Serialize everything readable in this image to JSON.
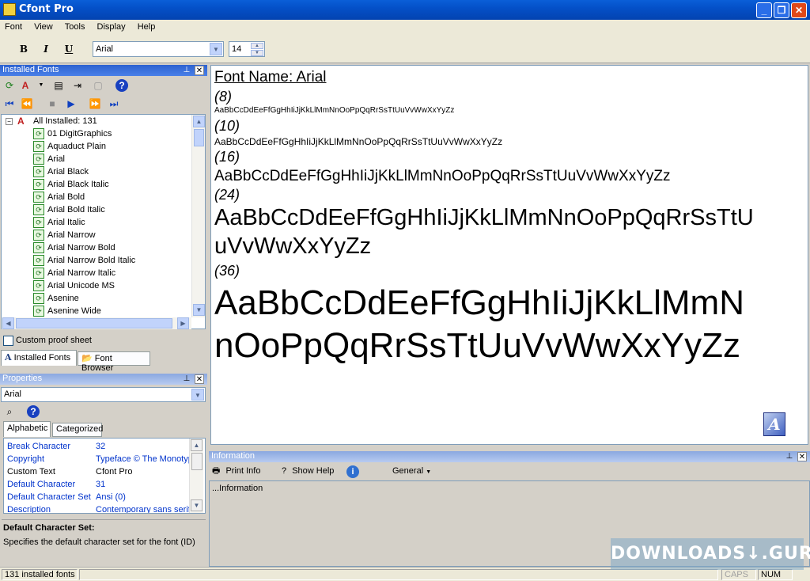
{
  "window": {
    "title": "Cfont Pro"
  },
  "menu": [
    "Font",
    "View",
    "Tools",
    "Display",
    "Help"
  ],
  "toolbar": {
    "bold": "B",
    "italic": "I",
    "underline": "U",
    "font_combo": "Arial",
    "size_value": "14"
  },
  "installed_panel": {
    "title": "Installed Fonts",
    "root_label": "All Installed: 131",
    "fonts": [
      "01 DigitGraphics",
      "Aquaduct    Plain",
      "Arial",
      "Arial Black",
      "Arial Black Italic",
      "Arial Bold",
      "Arial Bold Italic",
      "Arial Italic",
      "Arial Narrow",
      "Arial Narrow Bold",
      "Arial Narrow Bold Italic",
      "Arial Narrow Italic",
      "Arial Unicode MS",
      "Asenine",
      "Asenine Wide"
    ],
    "custom_proof_label": "Custom proof sheet",
    "tab_installed": "Installed Fonts",
    "tab_browser": "Font Browser"
  },
  "properties_panel": {
    "title": "Properties",
    "combo_value": "Arial",
    "tab_alpha": "Alphabetic",
    "tab_categorized": "Categorized",
    "rows": [
      {
        "k": "Break Character",
        "v": "32"
      },
      {
        "k": "Copyright",
        "v": "Typeface © The Monotype"
      },
      {
        "k": "Custom Text",
        "v": "Cfont Pro"
      },
      {
        "k": "Default Character",
        "v": "31"
      },
      {
        "k": "Default Character Set",
        "v": "Ansi (0)"
      },
      {
        "k": "Description",
        "v": "Contemporary sans serif design"
      }
    ],
    "desc_title": "Default Character Set:",
    "desc_text": "Specifies the default character set for the font (ID)"
  },
  "preview": {
    "font_name": "Font Name: Arial",
    "sizes": [
      "(8)",
      "(10)",
      "(16)",
      "(24)",
      "(36)"
    ],
    "sample8": "AaBbCcDdEeFfGgHhIiJjKkLlMmNnOoPpQqRrSsTtUuVvWwXxYyZz",
    "sample10": "AaBbCcDdEeFfGgHhIiJjKkLlMmNnOoPpQqRrSsTtUuVvWwXxYyZz",
    "sample16": "AaBbCcDdEeFfGgHhIiJjKkLlMmNnOoPpQqRrSsTtUuVvWwXxYyZz",
    "sample24_l1": "AaBbCcDdEeFfGgHhIiJjKkLlMmNnOoPpQqRrSsTtU",
    "sample24_l2": "uVvWwXxYyZz",
    "sample36_l1": "AaBbCcDdEeFfGgHhIiJjKkLlMmN",
    "sample36_l2": "nOoPpQqRrSsTtUuVvWwXxYyZz"
  },
  "info_panel": {
    "title": "Information",
    "print_info": "Print Info",
    "show_help": "Show Help",
    "general": "General",
    "content": "...Information"
  },
  "status": {
    "count": "131 installed fonts",
    "caps": "CAPS",
    "num": "NUM"
  },
  "watermark": "DOWNLOADS↓.GURU"
}
